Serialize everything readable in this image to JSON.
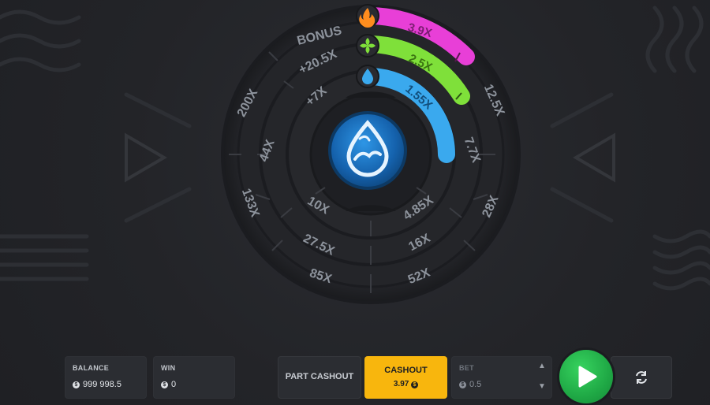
{
  "wheel": {
    "bonus_label": "BONUS",
    "outer_ring": [
      "+20.5X",
      "200X",
      "133X",
      "85X",
      "52X",
      "28X",
      "12.5X"
    ],
    "middle_ring": [
      "+7X",
      "44X",
      "27.5X",
      "16X",
      "7.7X"
    ],
    "inner_ring": [
      "10X",
      "4.85X"
    ],
    "bars": [
      {
        "label": "3.9X",
        "icon": "fire-icon",
        "color": "#e83fd7"
      },
      {
        "label": "2.5X",
        "icon": "leaf-icon",
        "color": "#7fe03a"
      },
      {
        "label": "1.55X",
        "icon": "water-drop-icon",
        "color": "#3aa9ee"
      }
    ],
    "center_icon": "water-wave-drop-icon"
  },
  "footer": {
    "balance_label": "BALANCE",
    "balance_value": "999 998.5",
    "win_label": "WIN",
    "win_value": "0",
    "part_cashout_label": "PART CASHOUT",
    "cashout_label": "CASHOUT",
    "cashout_value": "3.97",
    "bet_label": "BET",
    "bet_value": "0.5"
  },
  "colors": {
    "cashout": "#f8b60d",
    "play": "#1fa845",
    "fire_bar": "#e83fd7",
    "leaf_bar": "#7fe03a",
    "water_bar": "#3aa9ee"
  }
}
